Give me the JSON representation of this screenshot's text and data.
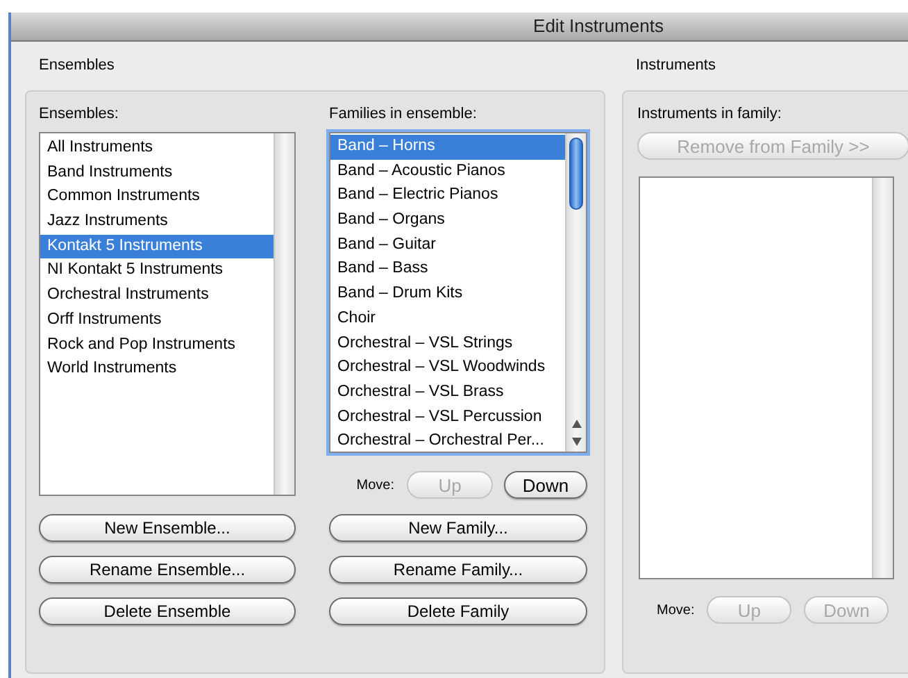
{
  "window": {
    "title": "Edit Instruments"
  },
  "ensembles_group": {
    "title": "Ensembles",
    "ensembles_label": "Ensembles:",
    "ensembles": [
      {
        "label": "All Instruments",
        "selected": false
      },
      {
        "label": "Band Instruments",
        "selected": false
      },
      {
        "label": "Common Instruments",
        "selected": false
      },
      {
        "label": "Jazz Instruments",
        "selected": false
      },
      {
        "label": "Kontakt 5 Instruments",
        "selected": true
      },
      {
        "label": "NI Kontakt 5 Instruments",
        "selected": false
      },
      {
        "label": "Orchestral Instruments",
        "selected": false
      },
      {
        "label": "Orff Instruments",
        "selected": false
      },
      {
        "label": "Rock and Pop Instruments",
        "selected": false
      },
      {
        "label": "World Instruments",
        "selected": false
      }
    ],
    "families_label": "Families in ensemble:",
    "families": [
      {
        "label": "Band – Horns",
        "selected": true
      },
      {
        "label": "Band – Acoustic Pianos",
        "selected": false
      },
      {
        "label": "Band – Electric Pianos",
        "selected": false
      },
      {
        "label": "Band – Organs",
        "selected": false
      },
      {
        "label": "Band – Guitar",
        "selected": false
      },
      {
        "label": "Band – Bass",
        "selected": false
      },
      {
        "label": "Band – Drum Kits",
        "selected": false
      },
      {
        "label": "Choir",
        "selected": false
      },
      {
        "label": "Orchestral – VSL Strings",
        "selected": false
      },
      {
        "label": "Orchestral – VSL Woodwinds",
        "selected": false
      },
      {
        "label": "Orchestral – VSL Brass",
        "selected": false
      },
      {
        "label": "Orchestral – VSL Percussion",
        "selected": false
      },
      {
        "label": "Orchestral – Orchestral Per...",
        "selected": false
      }
    ],
    "move_label": "Move:",
    "move_buttons": [
      {
        "label": "Up",
        "disabled": true
      },
      {
        "label": "Down",
        "disabled": false
      }
    ],
    "ensemble_buttons": [
      {
        "label": "New Ensemble...",
        "disabled": false
      },
      {
        "label": "Rename Ensemble...",
        "disabled": false
      },
      {
        "label": "Delete Ensemble",
        "disabled": false
      }
    ],
    "family_buttons": [
      {
        "label": "New Family...",
        "disabled": false
      },
      {
        "label": "Rename Family...",
        "disabled": false
      },
      {
        "label": "Delete Family",
        "disabled": false
      }
    ]
  },
  "instruments_group": {
    "title": "Instruments",
    "label": "Instruments in family:",
    "remove_button": {
      "label": "Remove from Family >>",
      "disabled": true
    },
    "move_label": "Move:",
    "move_buttons": [
      {
        "label": "Up",
        "disabled": true
      },
      {
        "label": "Down",
        "disabled": true
      }
    ]
  }
}
